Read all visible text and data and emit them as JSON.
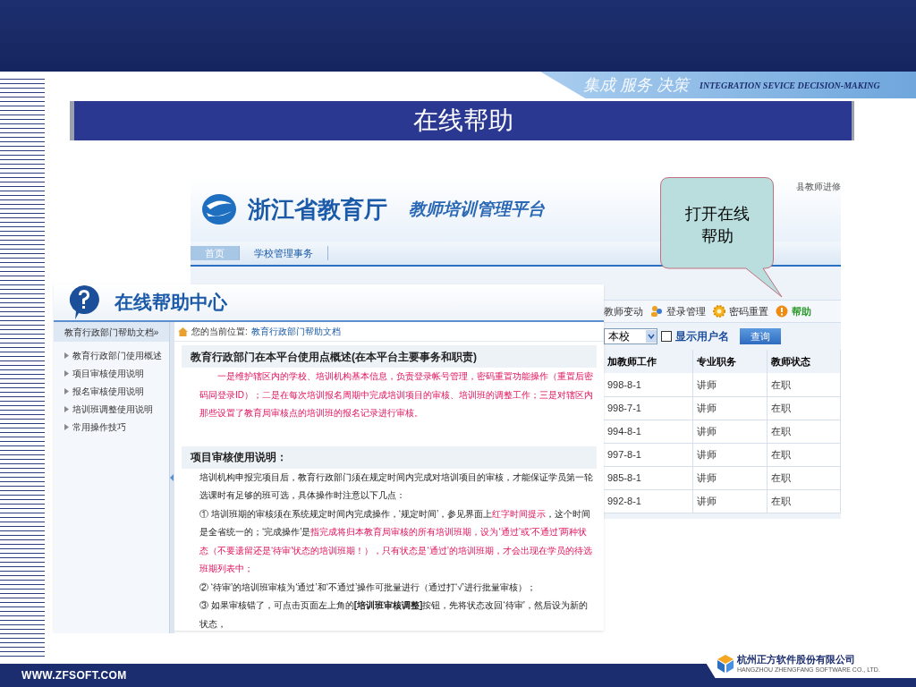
{
  "header": {
    "slogan_cn": "集成 服务 决策",
    "slogan_en": "INTEGRATION SEVICE DECISION-MAKING"
  },
  "title": "在线帮助",
  "platform_window": {
    "corner_text": "县教师进修",
    "org_name": "浙江省教育厅",
    "platform_name": "教师培训管理平台",
    "nav": [
      {
        "label": "首页",
        "selected": true
      },
      {
        "label": "学校管理事务",
        "selected": false
      }
    ],
    "toolbar": [
      {
        "label": "教师变动",
        "kind": "plain"
      },
      {
        "label": "登录管理",
        "kind": "users"
      },
      {
        "label": "密码重置",
        "kind": "gear"
      },
      {
        "label": "帮助",
        "kind": "info"
      }
    ],
    "filter": {
      "scope": "本校",
      "show_username": {
        "label": "显示用户名",
        "checked": false
      },
      "button": "查询"
    },
    "table": {
      "columns": [
        "加教师工作",
        "专业职务",
        "教师状态"
      ],
      "rows": [
        [
          "998-8-1",
          "讲师",
          "在职"
        ],
        [
          "998-7-1",
          "讲师",
          "在职"
        ],
        [
          "994-8-1",
          "讲师",
          "在职"
        ],
        [
          "997-8-1",
          "讲师",
          "在职"
        ],
        [
          "985-8-1",
          "讲师",
          "在职"
        ],
        [
          "992-8-1",
          "讲师",
          "在职"
        ]
      ]
    }
  },
  "callout": "打开在线帮助",
  "help_window": {
    "title": "在线帮助中心",
    "sidebar": {
      "header": "教育行政部门帮助文档»",
      "items": [
        "教育行政部门使用概述",
        "项目审核使用说明",
        "报名审核使用说明",
        "培训班调整使用说明",
        "常用操作技巧"
      ]
    },
    "breadcrumb": {
      "label": "您的当前位置:",
      "path": "教育行政部门帮助文档"
    },
    "sections": [
      {
        "title": "教育行政部门在本平台使用点概述(在本平台主要事务和职责)",
        "paragraphs": [
          {
            "indent": true,
            "runs": [
              {
                "text": "一是维护辖区内的学校、培训机构基本信息，负责登录帐号管理，密码重置功能操作（重置后密码同登录ID）；二是在每次培训报名周期中完成培训项目的审核、培训班的调整工作；三是对辖区内那些设置了教育局审核点的培训班的报名记录进行审核。",
                "highlighted": true
              }
            ]
          }
        ]
      },
      {
        "title": "项目审核使用说明：",
        "paragraphs": [
          {
            "indent": false,
            "runs": [
              {
                "text": "培训机构申报完项目后，教育行政部门须在规定时间内完成对培训项目的审核，才能保证学员第一轮选课时有足够的班可选，具体操作时注意以下几点：",
                "highlighted": false
              }
            ]
          },
          {
            "indent": false,
            "runs": [
              {
                "text": "① 培训班期的审核须在系统规定时间内完成操作，‘规定时间’，参见界面上",
                "highlighted": false
              },
              {
                "text": "红字时间提示",
                "highlighted": true
              },
              {
                "text": "，这个时间是全省统一的；‘完成操作’是",
                "highlighted": false
              },
              {
                "text": "指完成将归本教育局审核的所有培训班期，设为‘通过’或‘不通过’两种状态（不要遗留还是‘待审’状态的培训班期！），只有状态是‘通过’的培训班期，才会出现在学员的待选班期列表中；",
                "highlighted": true
              }
            ]
          },
          {
            "indent": false,
            "runs": [
              {
                "text": "② ‘待审’的培训班审核为‘通过’和‘不通过’操作可批量进行（通过打‘√’进行批量审核）；",
                "highlighted": false
              }
            ]
          },
          {
            "indent": false,
            "runs": [
              {
                "text": "③ 如果审核错了，可点击页面左上角的**[培训班审核调整]**按钮，先将状态改回‘待审’，然后设为新的状态，",
                "highlighted": false
              }
            ]
          }
        ]
      }
    ]
  },
  "footer": {
    "url": "WWW.ZFSOFT.COM",
    "company_cn": "杭州正方软件股份有限公司",
    "company_en": "HANGZHOU ZHENGFANG SOFTWARE CO., LTD."
  }
}
